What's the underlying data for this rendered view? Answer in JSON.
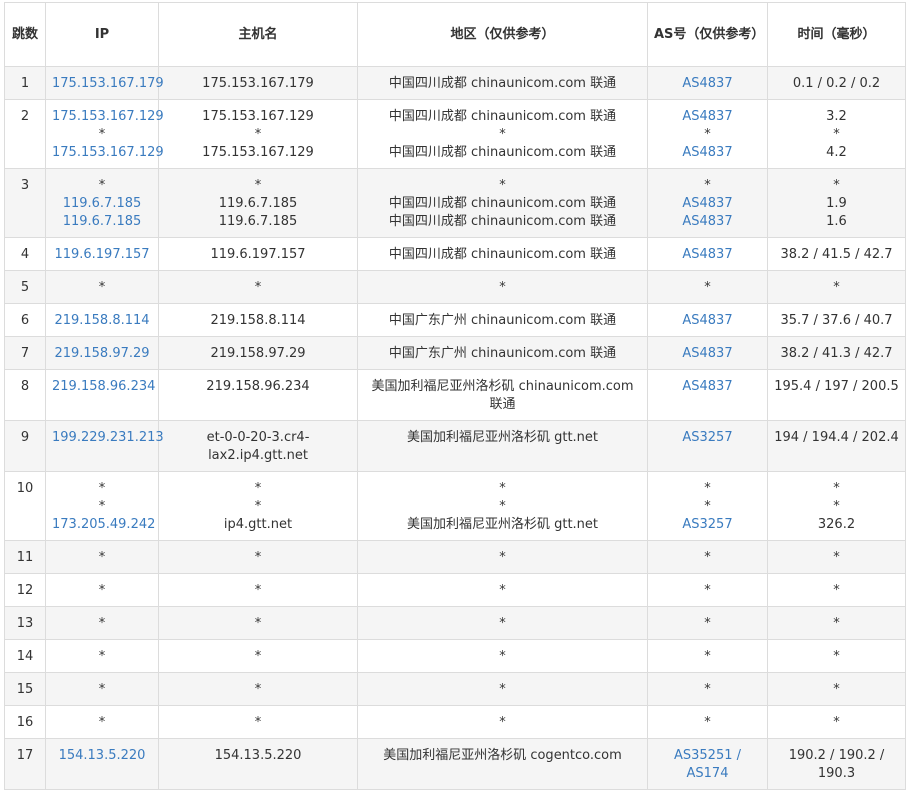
{
  "headers": {
    "hop": "跳数",
    "ip": "IP",
    "host": "主机名",
    "region": "地区（仅供参考）",
    "as": "AS号（仅供参考）",
    "time": "时间（毫秒）"
  },
  "rows": [
    {
      "hop": "1",
      "ip": [
        "175.153.167.179"
      ],
      "host": [
        "175.153.167.179"
      ],
      "region": [
        "中国四川成都 chinaunicom.com 联通"
      ],
      "as": [
        "AS4837"
      ],
      "time": [
        "0.1 / 0.2 / 0.2"
      ]
    },
    {
      "hop": "2",
      "ip": [
        "175.153.167.129",
        "*",
        "175.153.167.129"
      ],
      "host": [
        "175.153.167.129",
        "*",
        "175.153.167.129"
      ],
      "region": [
        "中国四川成都 chinaunicom.com 联通",
        "*",
        "中国四川成都 chinaunicom.com 联通"
      ],
      "as": [
        "AS4837",
        "*",
        "AS4837"
      ],
      "time": [
        "3.2",
        "*",
        "4.2"
      ]
    },
    {
      "hop": "3",
      "ip": [
        "*",
        "119.6.7.185",
        "119.6.7.185"
      ],
      "host": [
        "*",
        "119.6.7.185",
        "119.6.7.185"
      ],
      "region": [
        "*",
        "中国四川成都 chinaunicom.com 联通",
        "中国四川成都 chinaunicom.com 联通"
      ],
      "as": [
        "*",
        "AS4837",
        "AS4837"
      ],
      "time": [
        "*",
        "1.9",
        "1.6"
      ]
    },
    {
      "hop": "4",
      "ip": [
        "119.6.197.157"
      ],
      "host": [
        "119.6.197.157"
      ],
      "region": [
        "中国四川成都 chinaunicom.com 联通"
      ],
      "as": [
        "AS4837"
      ],
      "time": [
        "38.2 / 41.5 / 42.7"
      ]
    },
    {
      "hop": "5",
      "ip": [
        "*"
      ],
      "host": [
        "*"
      ],
      "region": [
        "*"
      ],
      "as": [
        "*"
      ],
      "time": [
        "*"
      ]
    },
    {
      "hop": "6",
      "ip": [
        "219.158.8.114"
      ],
      "host": [
        "219.158.8.114"
      ],
      "region": [
        "中国广东广州 chinaunicom.com 联通"
      ],
      "as": [
        "AS4837"
      ],
      "time": [
        "35.7 / 37.6 / 40.7"
      ]
    },
    {
      "hop": "7",
      "ip": [
        "219.158.97.29"
      ],
      "host": [
        "219.158.97.29"
      ],
      "region": [
        "中国广东广州 chinaunicom.com 联通"
      ],
      "as": [
        "AS4837"
      ],
      "time": [
        "38.2 / 41.3 / 42.7"
      ]
    },
    {
      "hop": "8",
      "ip": [
        "219.158.96.234"
      ],
      "host": [
        "219.158.96.234"
      ],
      "region": [
        "美国加利福尼亚州洛杉矶 chinaunicom.com 联通"
      ],
      "as": [
        "AS4837"
      ],
      "time": [
        "195.4 / 197 / 200.5"
      ]
    },
    {
      "hop": "9",
      "ip": [
        "199.229.231.213"
      ],
      "host": [
        "et-0-0-20-3.cr4-lax2.ip4.gtt.net"
      ],
      "region": [
        "美国加利福尼亚州洛杉矶 gtt.net"
      ],
      "as": [
        "AS3257"
      ],
      "time": [
        "194 / 194.4 / 202.4"
      ]
    },
    {
      "hop": "10",
      "ip": [
        "*",
        "*",
        "173.205.49.242"
      ],
      "host": [
        "*",
        "*",
        "ip4.gtt.net"
      ],
      "region": [
        "*",
        "*",
        "美国加利福尼亚州洛杉矶 gtt.net"
      ],
      "as": [
        "*",
        "*",
        "AS3257"
      ],
      "time": [
        "*",
        "*",
        "326.2"
      ]
    },
    {
      "hop": "11",
      "ip": [
        "*"
      ],
      "host": [
        "*"
      ],
      "region": [
        "*"
      ],
      "as": [
        "*"
      ],
      "time": [
        "*"
      ]
    },
    {
      "hop": "12",
      "ip": [
        "*"
      ],
      "host": [
        "*"
      ],
      "region": [
        "*"
      ],
      "as": [
        "*"
      ],
      "time": [
        "*"
      ]
    },
    {
      "hop": "13",
      "ip": [
        "*"
      ],
      "host": [
        "*"
      ],
      "region": [
        "*"
      ],
      "as": [
        "*"
      ],
      "time": [
        "*"
      ]
    },
    {
      "hop": "14",
      "ip": [
        "*"
      ],
      "host": [
        "*"
      ],
      "region": [
        "*"
      ],
      "as": [
        "*"
      ],
      "time": [
        "*"
      ]
    },
    {
      "hop": "15",
      "ip": [
        "*"
      ],
      "host": [
        "*"
      ],
      "region": [
        "*"
      ],
      "as": [
        "*"
      ],
      "time": [
        "*"
      ]
    },
    {
      "hop": "16",
      "ip": [
        "*"
      ],
      "host": [
        "*"
      ],
      "region": [
        "*"
      ],
      "as": [
        "*"
      ],
      "time": [
        "*"
      ]
    },
    {
      "hop": "17",
      "ip": [
        "154.13.5.220"
      ],
      "host": [
        "154.13.5.220"
      ],
      "region": [
        "美国加利福尼亚州洛杉矶 cogentco.com"
      ],
      "as": [
        "AS35251 / AS174"
      ],
      "time": [
        "190.2 / 190.2 / 190.3"
      ]
    }
  ],
  "colors": {
    "link": "#3a7bbf",
    "stripe": "#f5f5f5",
    "border": "#dcdcdc"
  }
}
